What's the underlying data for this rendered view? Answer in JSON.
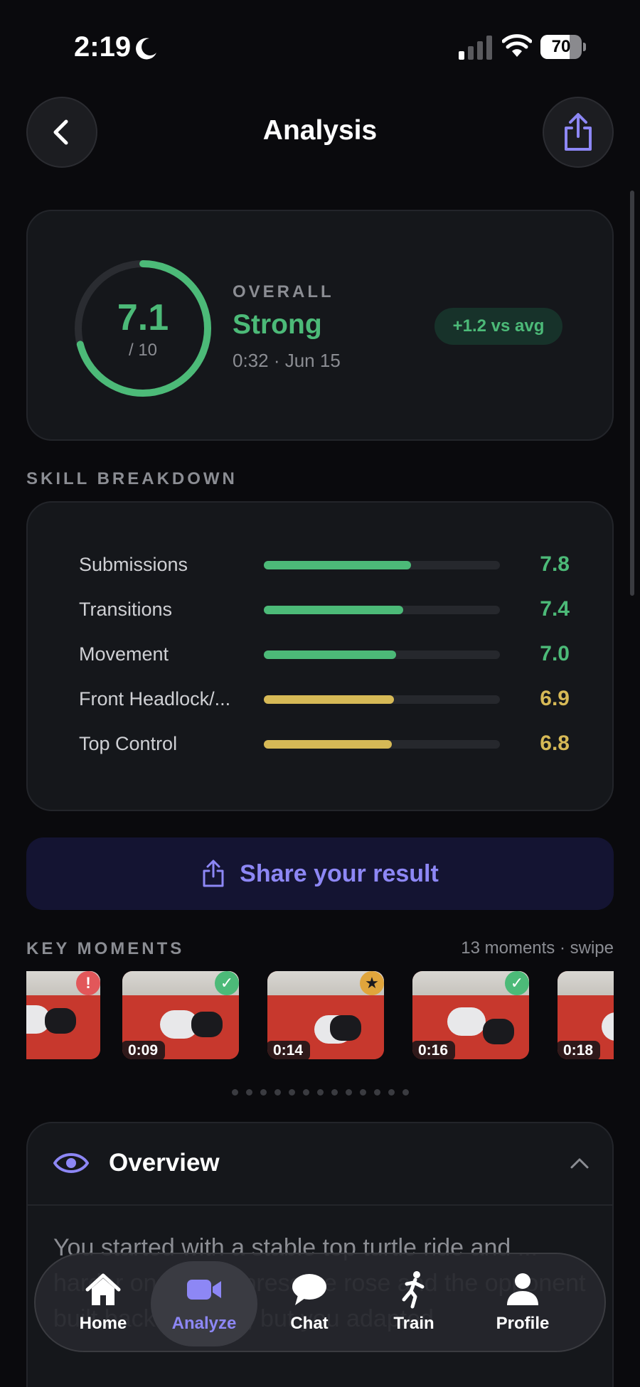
{
  "status_bar": {
    "time": "2:19",
    "battery": "70",
    "battery_level": 0.7
  },
  "header": {
    "title": "Analysis"
  },
  "overall": {
    "score": "7.1",
    "score_max": "/ 10",
    "score_fraction": 0.71,
    "label": "OVERALL",
    "rating": "Strong",
    "meta": "0:32 · Jun 15",
    "vs_avg": "+1.2 vs avg"
  },
  "skills": {
    "section_label": "SKILL BREAKDOWN",
    "items": [
      {
        "name": "Submissions",
        "value": "7.8",
        "level": 0.78,
        "color": "#4cba78"
      },
      {
        "name": "Transitions",
        "value": "7.4",
        "level": 0.74,
        "color": "#4cba78"
      },
      {
        "name": "Movement",
        "value": "7.0",
        "level": 0.7,
        "color": "#4cba78"
      },
      {
        "name": "Front Headlock/...",
        "value": "6.9",
        "level": 0.69,
        "color": "#d6b956"
      },
      {
        "name": "Top Control",
        "value": "6.8",
        "level": 0.68,
        "color": "#d6b956"
      }
    ]
  },
  "share_result": {
    "label": "Share your result"
  },
  "key_moments": {
    "section_label": "KEY MOMENTS",
    "meta": "13 moments · swipe",
    "items": [
      {
        "time": "",
        "badge": "alert-icon",
        "badge_color": "#e2575a"
      },
      {
        "time": "0:09",
        "badge": "check-icon",
        "badge_color": "#4cba78"
      },
      {
        "time": "0:14",
        "badge": "star-icon",
        "badge_color": "#e0a53c"
      },
      {
        "time": "0:16",
        "badge": "check-icon",
        "badge_color": "#4cba78"
      },
      {
        "time": "0:18",
        "badge": "",
        "badge_color": ""
      }
    ],
    "page_count": 13
  },
  "overview": {
    "title": "Overview",
    "text": "You started with a stable top turtle ride and ... harder once your pressure rose and the opponent built back into you, but you adapted"
  },
  "tab_bar": {
    "tabs": [
      {
        "label": "Home",
        "icon": "home-icon"
      },
      {
        "label": "Analyze",
        "icon": "video-camera-icon",
        "active": true
      },
      {
        "label": "Chat",
        "icon": "chat-bubble-icon"
      },
      {
        "label": "Train",
        "icon": "running-figure-icon"
      },
      {
        "label": "Profile",
        "icon": "person-icon"
      }
    ]
  },
  "colors": {
    "accent": "#8d87f5",
    "good": "#4cba78",
    "ok": "#d6b956"
  }
}
